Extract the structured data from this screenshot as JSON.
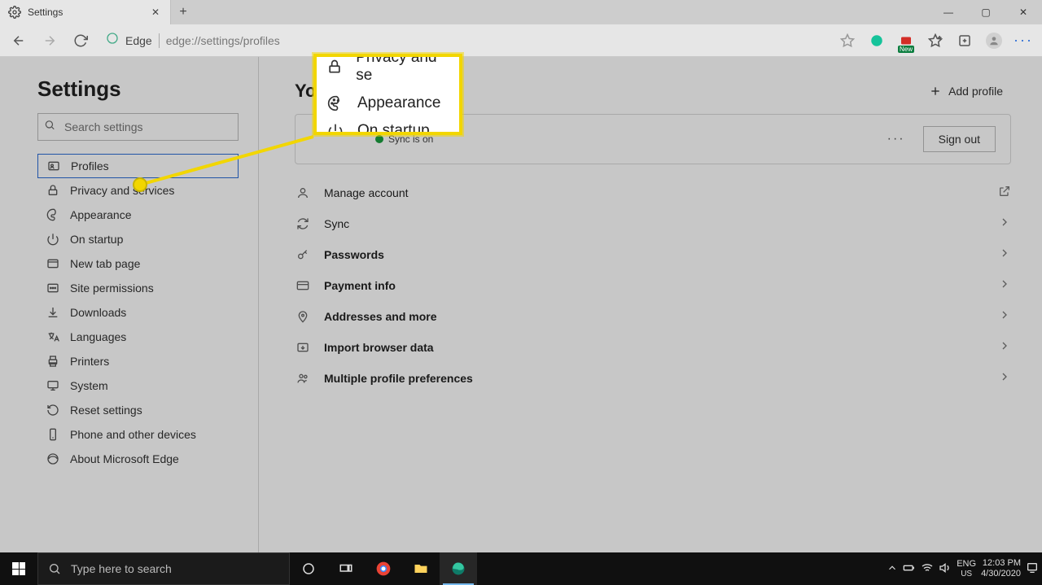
{
  "window": {
    "tab_title": "Settings",
    "min": "—",
    "max": "▢",
    "close": "✕"
  },
  "toolbar": {
    "edge_label": "Edge",
    "url": "edge://settings/profiles"
  },
  "ext_badge": "New",
  "sidebar": {
    "title": "Settings",
    "search_placeholder": "Search settings",
    "items": [
      {
        "label": "Profiles",
        "icon": "profile-card-icon",
        "active": true
      },
      {
        "label": "Privacy and services",
        "icon": "lock-icon"
      },
      {
        "label": "Appearance",
        "icon": "palette-icon"
      },
      {
        "label": "On startup",
        "icon": "power-icon"
      },
      {
        "label": "New tab page",
        "icon": "newtab-icon"
      },
      {
        "label": "Site permissions",
        "icon": "permissions-icon"
      },
      {
        "label": "Downloads",
        "icon": "download-icon"
      },
      {
        "label": "Languages",
        "icon": "languages-icon"
      },
      {
        "label": "Printers",
        "icon": "printer-icon"
      },
      {
        "label": "System",
        "icon": "system-icon"
      },
      {
        "label": "Reset settings",
        "icon": "reset-icon"
      },
      {
        "label": "Phone and other devices",
        "icon": "phone-icon"
      },
      {
        "label": "About Microsoft Edge",
        "icon": "edge-icon"
      }
    ]
  },
  "main": {
    "heading_partial": "Yo",
    "add_profile_label": "Add profile",
    "sync_label": "Sync is on",
    "more_label": "···",
    "signout_label": "Sign out",
    "rows": [
      {
        "label": "Manage account",
        "icon": "person-icon",
        "action": "external"
      },
      {
        "label": "Sync",
        "icon": "sync-icon",
        "action": "chevron"
      },
      {
        "label": "Passwords",
        "icon": "key-icon",
        "action": "chevron",
        "bold": true
      },
      {
        "label": "Payment info",
        "icon": "card-icon",
        "action": "chevron",
        "bold": true
      },
      {
        "label": "Addresses and more",
        "icon": "pin-icon",
        "action": "chevron",
        "bold": true
      },
      {
        "label": "Import browser data",
        "icon": "import-icon",
        "action": "chevron",
        "bold": true
      },
      {
        "label": "Multiple profile preferences",
        "icon": "people-icon",
        "action": "chevron",
        "bold": true
      }
    ]
  },
  "callout": {
    "row1": "Privacy and se",
    "row2": "Appearance",
    "row3": "On startup"
  },
  "taskbar": {
    "search_placeholder": "Type here to search",
    "lang1": "ENG",
    "lang2": "US",
    "time": "12:03 PM",
    "date": "4/30/2020"
  }
}
